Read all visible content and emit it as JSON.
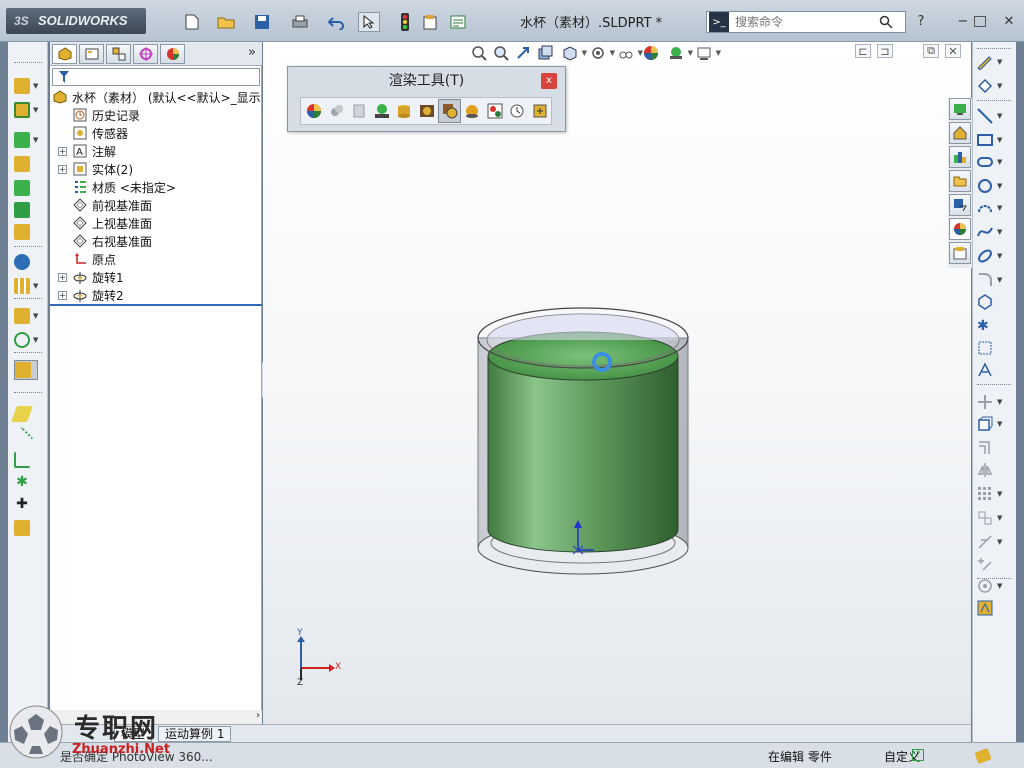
{
  "app": {
    "logo_text": "SOLIDWORKS",
    "logo_prefix": "3S"
  },
  "title_bar": {
    "document_title": "水杯（素材）.SLDPRT *",
    "search_placeholder": "搜索命令",
    "help_label": "?",
    "window_controls": [
      "minimize",
      "restore",
      "close"
    ]
  },
  "feature_manager": {
    "tabs": [
      "feature-manager-icon",
      "property-manager-icon",
      "configuration-manager-icon",
      "dimxpert-icon",
      "display-manager-icon"
    ],
    "more_label": "»",
    "tree": [
      {
        "label": "水杯（素材）  (默认<<默认>_显示",
        "icon": "part-icon",
        "expandable": false
      },
      {
        "label": "历史记录",
        "icon": "history-icon",
        "expandable": false
      },
      {
        "label": "传感器",
        "icon": "sensor-icon",
        "expandable": false
      },
      {
        "label": "注解",
        "icon": "annotation-icon",
        "expandable": true
      },
      {
        "label": "实体(2)",
        "icon": "solid-bodies-icon",
        "expandable": true
      },
      {
        "label": "材质 <未指定>",
        "icon": "material-icon",
        "expandable": false
      },
      {
        "label": "前视基准面",
        "icon": "plane-icon",
        "expandable": false
      },
      {
        "label": "上视基准面",
        "icon": "plane-icon",
        "expandable": false
      },
      {
        "label": "右视基准面",
        "icon": "plane-icon",
        "expandable": false
      },
      {
        "label": "原点",
        "icon": "origin-icon",
        "expandable": false
      },
      {
        "label": "旋转1",
        "icon": "revolve-icon",
        "expandable": true
      },
      {
        "label": "旋转2",
        "icon": "revolve-icon",
        "expandable": true
      }
    ]
  },
  "render_toolbar": {
    "title": "渲染工具(T)",
    "close_label": "x",
    "buttons": [
      "edit-appearance-icon",
      "copy-appearance-icon",
      "paste-appearance-icon",
      "edit-scene-icon",
      "edit-decal-icon",
      "preview-window-icon",
      "integrated-preview-icon",
      "final-render-icon",
      "options-icon",
      "schedule-render-icon",
      "recall-render-icon"
    ],
    "pressed_index": 6
  },
  "bottom_tabs": [
    "模型",
    "运动算例 1"
  ],
  "status_bar": {
    "left_text": "是否确定 PhotoView 360...",
    "mode_text": "在编辑 零件",
    "units_text": "自定义"
  },
  "triad": {
    "x_label": "X",
    "y_label": "Y",
    "z_label": "Z"
  },
  "watermark": {
    "text": "专职网",
    "url": "Zhuanzhi.Net"
  },
  "colors": {
    "titlebar": "#c3cdd8",
    "viewport_top": "#ffffff",
    "liquid_green": "#5e9a5c",
    "glass": "#c9cdd3",
    "accent_blue": "#2f6cb3"
  }
}
